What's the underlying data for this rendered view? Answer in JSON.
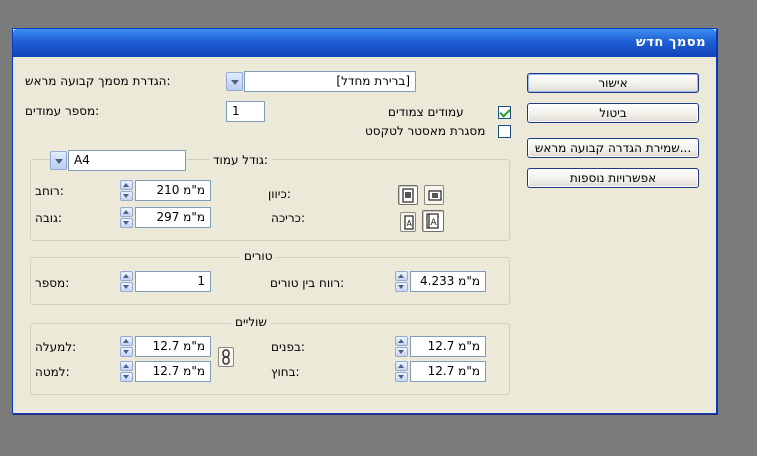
{
  "dialog": {
    "title": "מסמך חדש"
  },
  "buttons": {
    "ok": "אישור",
    "cancel": "ביטול",
    "save_preset": "שמירת הגדרה קבועה מראש...",
    "more_options": "אפשרויות נוספות"
  },
  "preset": {
    "label": "הגדרת מסמך קבועה מראש:",
    "value": "[ברירת מחדל]"
  },
  "pages": {
    "label": "מספר עמודים:",
    "value": "1"
  },
  "facing_pages": {
    "label": "עמודים צמודים",
    "checked": true
  },
  "master_text_frame": {
    "label": "מסגרת מאסטר לטקסט",
    "checked": false
  },
  "page_size": {
    "label": "גודל עמוד:",
    "value": "A4",
    "width": {
      "label": "רוחב:",
      "value": "210 מ\"מ"
    },
    "height": {
      "label": "גובה:",
      "value": "297 מ\"מ"
    },
    "orientation_label": "כיוון:",
    "binding_label": "כריכה:",
    "icons": {
      "portrait": "portrait-orientation-icon",
      "landscape": "landscape-orientation-icon",
      "binding_left": "left-edge-binding-icon",
      "binding_right": "right-edge-binding-icon"
    }
  },
  "columns": {
    "title": "טורים",
    "number": {
      "label": "מספר:",
      "value": "1"
    },
    "gutter": {
      "label": "רווח בין טורים:",
      "value": "4.233 מ\"מ"
    }
  },
  "margins": {
    "title": "שוליים",
    "top": {
      "label": "למעלה:",
      "value": "12.7 מ\"מ"
    },
    "bottom": {
      "label": "למטה:",
      "value": "12.7 מ\"מ"
    },
    "inside": {
      "label": "בפנים:",
      "value": "12.7 מ\"מ"
    },
    "outside": {
      "label": "בחוץ:",
      "value": "12.7 מ\"מ"
    },
    "link_icon": "chain-link-icon"
  },
  "colors": {
    "title_bar": "#1f5fd6",
    "dialog_bg": "#ece9d8",
    "desktop": "#7b7b7b"
  }
}
